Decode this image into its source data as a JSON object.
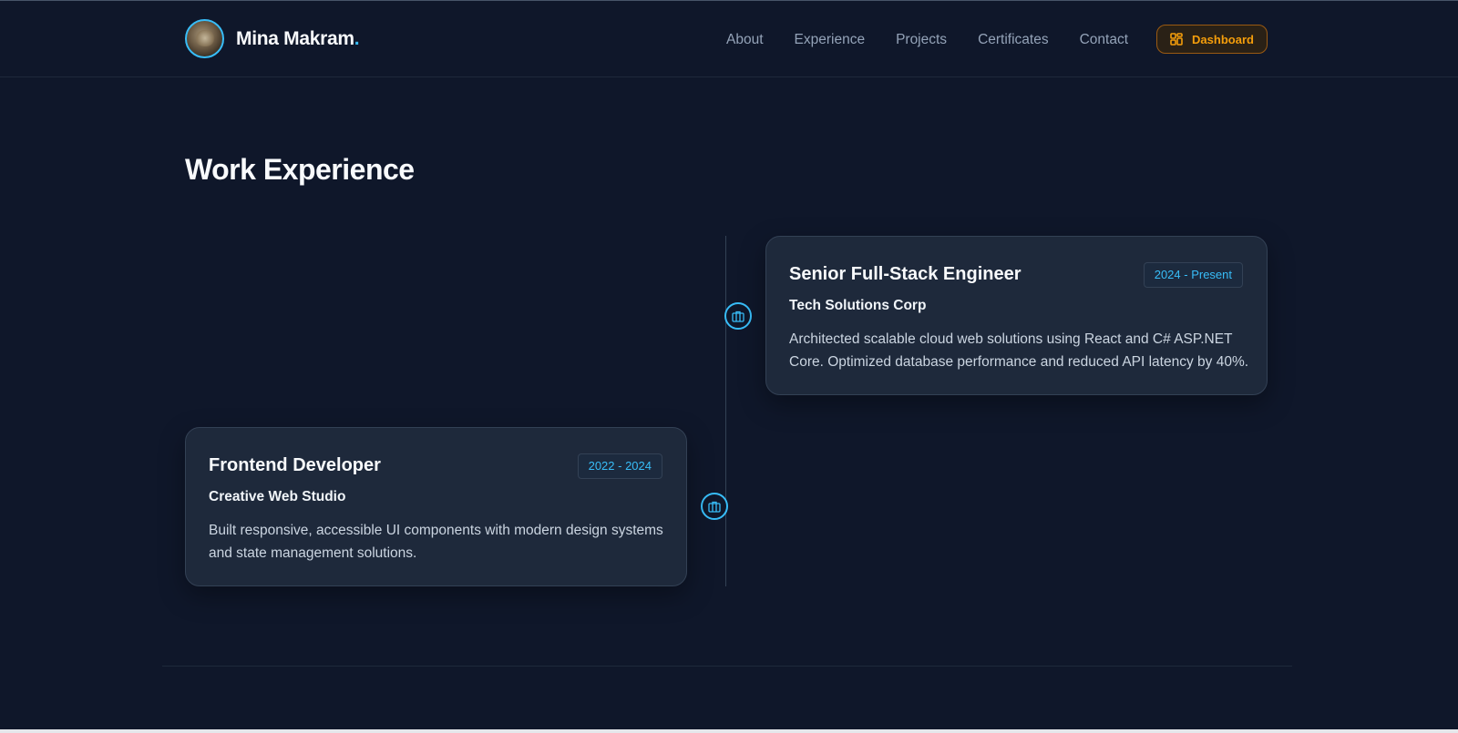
{
  "brand": {
    "name": "Mina Makram",
    "dot": "."
  },
  "nav": {
    "items": [
      {
        "label": "About"
      },
      {
        "label": "Experience"
      },
      {
        "label": "Projects"
      },
      {
        "label": "Certificates"
      },
      {
        "label": "Contact"
      }
    ],
    "dashboard_label": "Dashboard"
  },
  "experience": {
    "title": "Work Experience",
    "jobs": [
      {
        "title": "Senior Full-Stack Engineer",
        "period": "2024 - Present",
        "company": "Tech Solutions Corp",
        "description": "Architected scalable cloud web solutions using React and C# ASP.NET Core. Optimized database performance and reduced API latency by 40%."
      },
      {
        "title": "Frontend Developer",
        "period": "2022 - 2024",
        "company": "Creative Web Studio",
        "description": "Built responsive, accessible UI components with modern design systems and state management solutions."
      }
    ]
  },
  "colors": {
    "background": "#0f172a",
    "card": "#1e293b",
    "accent": "#38bdf8",
    "dashboard": "#f59e0b"
  },
  "icons": {
    "avatar": "profile-photo",
    "dashboard": "grid-icon",
    "timeline_node": "briefcase-icon"
  }
}
